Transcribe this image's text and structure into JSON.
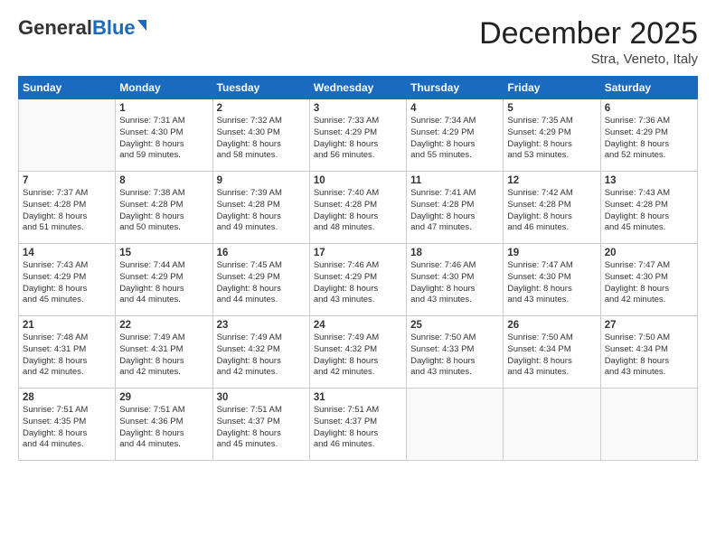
{
  "header": {
    "logo_general": "General",
    "logo_blue": "Blue",
    "month": "December 2025",
    "location": "Stra, Veneto, Italy"
  },
  "days_of_week": [
    "Sunday",
    "Monday",
    "Tuesday",
    "Wednesday",
    "Thursday",
    "Friday",
    "Saturday"
  ],
  "weeks": [
    [
      {
        "day": "",
        "info": ""
      },
      {
        "day": "1",
        "info": "Sunrise: 7:31 AM\nSunset: 4:30 PM\nDaylight: 8 hours\nand 59 minutes."
      },
      {
        "day": "2",
        "info": "Sunrise: 7:32 AM\nSunset: 4:30 PM\nDaylight: 8 hours\nand 58 minutes."
      },
      {
        "day": "3",
        "info": "Sunrise: 7:33 AM\nSunset: 4:29 PM\nDaylight: 8 hours\nand 56 minutes."
      },
      {
        "day": "4",
        "info": "Sunrise: 7:34 AM\nSunset: 4:29 PM\nDaylight: 8 hours\nand 55 minutes."
      },
      {
        "day": "5",
        "info": "Sunrise: 7:35 AM\nSunset: 4:29 PM\nDaylight: 8 hours\nand 53 minutes."
      },
      {
        "day": "6",
        "info": "Sunrise: 7:36 AM\nSunset: 4:29 PM\nDaylight: 8 hours\nand 52 minutes."
      }
    ],
    [
      {
        "day": "7",
        "info": "Sunrise: 7:37 AM\nSunset: 4:28 PM\nDaylight: 8 hours\nand 51 minutes."
      },
      {
        "day": "8",
        "info": "Sunrise: 7:38 AM\nSunset: 4:28 PM\nDaylight: 8 hours\nand 50 minutes."
      },
      {
        "day": "9",
        "info": "Sunrise: 7:39 AM\nSunset: 4:28 PM\nDaylight: 8 hours\nand 49 minutes."
      },
      {
        "day": "10",
        "info": "Sunrise: 7:40 AM\nSunset: 4:28 PM\nDaylight: 8 hours\nand 48 minutes."
      },
      {
        "day": "11",
        "info": "Sunrise: 7:41 AM\nSunset: 4:28 PM\nDaylight: 8 hours\nand 47 minutes."
      },
      {
        "day": "12",
        "info": "Sunrise: 7:42 AM\nSunset: 4:28 PM\nDaylight: 8 hours\nand 46 minutes."
      },
      {
        "day": "13",
        "info": "Sunrise: 7:43 AM\nSunset: 4:28 PM\nDaylight: 8 hours\nand 45 minutes."
      }
    ],
    [
      {
        "day": "14",
        "info": "Sunrise: 7:43 AM\nSunset: 4:29 PM\nDaylight: 8 hours\nand 45 minutes."
      },
      {
        "day": "15",
        "info": "Sunrise: 7:44 AM\nSunset: 4:29 PM\nDaylight: 8 hours\nand 44 minutes."
      },
      {
        "day": "16",
        "info": "Sunrise: 7:45 AM\nSunset: 4:29 PM\nDaylight: 8 hours\nand 44 minutes."
      },
      {
        "day": "17",
        "info": "Sunrise: 7:46 AM\nSunset: 4:29 PM\nDaylight: 8 hours\nand 43 minutes."
      },
      {
        "day": "18",
        "info": "Sunrise: 7:46 AM\nSunset: 4:30 PM\nDaylight: 8 hours\nand 43 minutes."
      },
      {
        "day": "19",
        "info": "Sunrise: 7:47 AM\nSunset: 4:30 PM\nDaylight: 8 hours\nand 43 minutes."
      },
      {
        "day": "20",
        "info": "Sunrise: 7:47 AM\nSunset: 4:30 PM\nDaylight: 8 hours\nand 42 minutes."
      }
    ],
    [
      {
        "day": "21",
        "info": "Sunrise: 7:48 AM\nSunset: 4:31 PM\nDaylight: 8 hours\nand 42 minutes."
      },
      {
        "day": "22",
        "info": "Sunrise: 7:49 AM\nSunset: 4:31 PM\nDaylight: 8 hours\nand 42 minutes."
      },
      {
        "day": "23",
        "info": "Sunrise: 7:49 AM\nSunset: 4:32 PM\nDaylight: 8 hours\nand 42 minutes."
      },
      {
        "day": "24",
        "info": "Sunrise: 7:49 AM\nSunset: 4:32 PM\nDaylight: 8 hours\nand 42 minutes."
      },
      {
        "day": "25",
        "info": "Sunrise: 7:50 AM\nSunset: 4:33 PM\nDaylight: 8 hours\nand 43 minutes."
      },
      {
        "day": "26",
        "info": "Sunrise: 7:50 AM\nSunset: 4:34 PM\nDaylight: 8 hours\nand 43 minutes."
      },
      {
        "day": "27",
        "info": "Sunrise: 7:50 AM\nSunset: 4:34 PM\nDaylight: 8 hours\nand 43 minutes."
      }
    ],
    [
      {
        "day": "28",
        "info": "Sunrise: 7:51 AM\nSunset: 4:35 PM\nDaylight: 8 hours\nand 44 minutes."
      },
      {
        "day": "29",
        "info": "Sunrise: 7:51 AM\nSunset: 4:36 PM\nDaylight: 8 hours\nand 44 minutes."
      },
      {
        "day": "30",
        "info": "Sunrise: 7:51 AM\nSunset: 4:37 PM\nDaylight: 8 hours\nand 45 minutes."
      },
      {
        "day": "31",
        "info": "Sunrise: 7:51 AM\nSunset: 4:37 PM\nDaylight: 8 hours\nand 46 minutes."
      },
      {
        "day": "",
        "info": ""
      },
      {
        "day": "",
        "info": ""
      },
      {
        "day": "",
        "info": ""
      }
    ]
  ]
}
